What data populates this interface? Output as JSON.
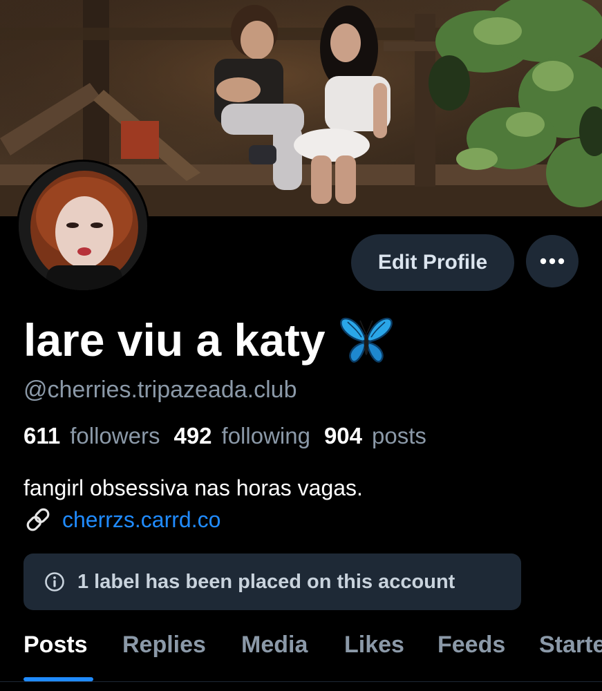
{
  "profile": {
    "display_name": "lare viu a katy",
    "name_emoji": "butterfly-icon",
    "handle": "@cherries.tripazeada.club",
    "bio": "fangirl obsessiva nas horas vagas.",
    "link": "cherrzs.carrd.co"
  },
  "stats": {
    "followers_count": "611",
    "followers_label": "followers",
    "following_count": "492",
    "following_label": "following",
    "posts_count": "904",
    "posts_label": "posts"
  },
  "actions": {
    "edit_profile_label": "Edit Profile",
    "more_icon": "ellipsis-icon"
  },
  "moderation": {
    "label_notice": "1 label has been placed on this account",
    "icon": "info-icon"
  },
  "tabs": [
    {
      "label": "Posts",
      "active": true
    },
    {
      "label": "Replies",
      "active": false
    },
    {
      "label": "Media",
      "active": false
    },
    {
      "label": "Likes",
      "active": false
    },
    {
      "label": "Feeds",
      "active": false
    },
    {
      "label": "Starter Packs",
      "active": false
    }
  ],
  "colors": {
    "background": "#000000",
    "button_bg": "#1e2936",
    "muted_text": "#8b99a8",
    "accent": "#208bfe",
    "butterfly": "#2aa6e8"
  }
}
